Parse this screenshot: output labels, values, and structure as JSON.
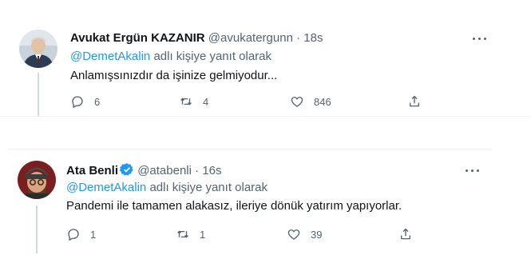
{
  "tweets": [
    {
      "name": "Avukat Ergün KAZANIR",
      "handle": "@avukatergunn",
      "separator": "·",
      "time": "18s",
      "reply_mention": "@DemetAkalin",
      "reply_text": "adlı kişiye yanıt olarak",
      "text": "Anlamışsınızdır da işinize gelmiyodur...",
      "replies": "6",
      "retweets": "4",
      "likes": "846",
      "verified": false
    },
    {
      "name": "Ata Benli",
      "handle": "@atabenli",
      "separator": "·",
      "time": "16s",
      "reply_mention": "@DemetAkalin",
      "reply_text": "adlı kişiye yanıt olarak",
      "text": "Pandemi ile tamamen alakasız, ileriye dönük yatırım yapıyorlar.",
      "replies": "1",
      "retweets": "1",
      "likes": "39",
      "verified": true
    }
  ],
  "colors": {
    "accent": "#1d9bf0",
    "muted": "#536471",
    "text": "#0f1419",
    "divider": "#eff3f4"
  },
  "icons": [
    "reply-icon",
    "retweet-icon",
    "like-icon",
    "share-icon",
    "more-icon",
    "verified-badge-icon"
  ]
}
